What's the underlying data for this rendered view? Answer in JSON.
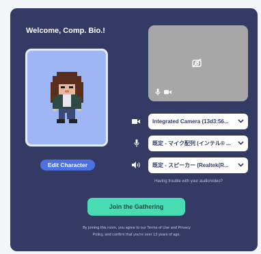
{
  "welcome": {
    "title": "Welcome, Comp. Bio.!"
  },
  "avatar": {
    "edit_label": "Edit Character"
  },
  "preview": {
    "camera_off_icon": "camera-off-icon",
    "mic_icon": "microphone-icon",
    "video_icon": "video-camera-icon"
  },
  "devices": {
    "camera": {
      "value": "Integrated Camera (13d3:56...",
      "icon": "video-camera-icon"
    },
    "microphone": {
      "value": "既定 - マイク配列 (インテル® ...",
      "icon": "microphone-icon"
    },
    "speaker": {
      "value": "既定 - スピーカー (Realtek(R...",
      "icon": "speaker-icon"
    }
  },
  "help": {
    "trouble_link": "Having trouble with your audio/video?"
  },
  "join": {
    "label": "Join the Gathering"
  },
  "legal": {
    "line1": "By joining this room, you agree to our Terms of Use and Privacy",
    "line2": "Policy, and confirm that you're over 13 years of age."
  },
  "colors": {
    "panel": "#333a64",
    "join_button": "#47dcb2",
    "edit_button": "#4d72df",
    "avatar_bg": "#9fb6f5"
  }
}
